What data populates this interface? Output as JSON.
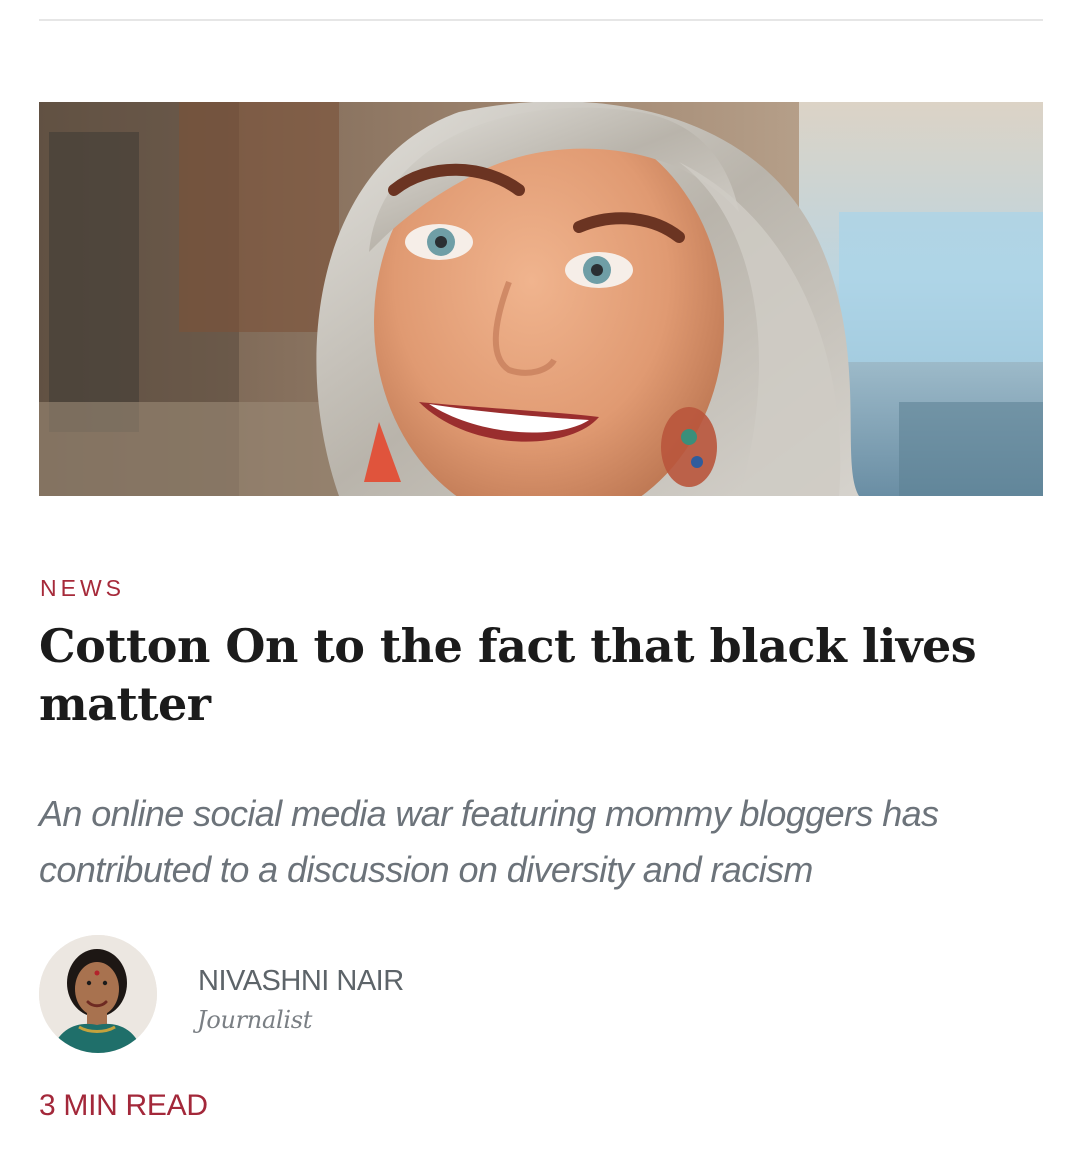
{
  "article": {
    "category": "NEWS",
    "headline": "Cotton On to the fact that black lives matter",
    "subheadline": "An online social media war featuring mommy bloggers has contributed to a discussion on diversity and racism",
    "read_time": "3 MIN READ"
  },
  "author": {
    "name": "NIVASHNI NAIR",
    "role": "Journalist"
  },
  "images": {
    "hero": "smiling-woman-portrait-photo",
    "avatar": "author-portrait-photo"
  },
  "colors": {
    "accent": "#a62a3a",
    "headline": "#1b1b1b",
    "subhead": "#6c737a",
    "author_name": "#5d6469"
  }
}
